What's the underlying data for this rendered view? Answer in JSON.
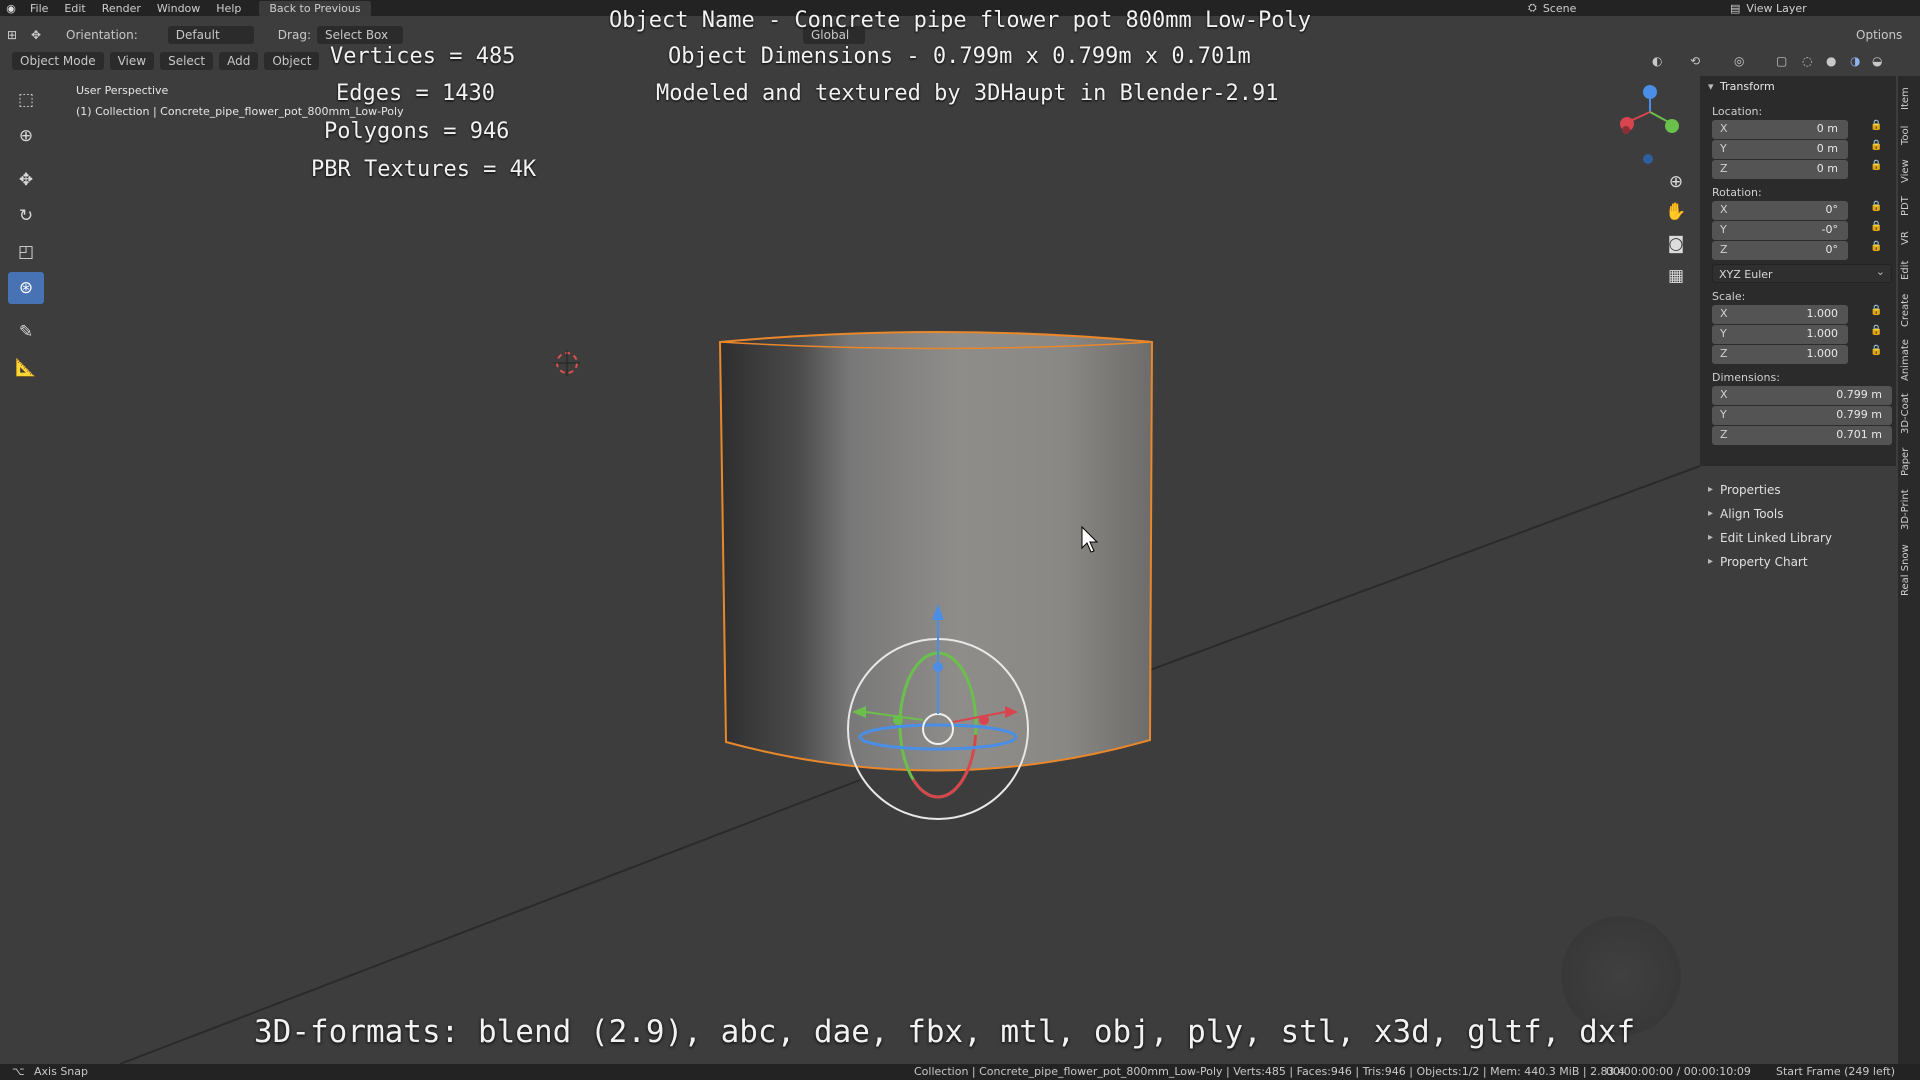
{
  "topbar": {
    "menus": [
      "File",
      "Edit",
      "Render",
      "Window",
      "Help"
    ],
    "back_button": "Back to Previous",
    "scene": "Scene",
    "view_layer": "View Layer"
  },
  "header": {
    "orientation_label": "Orientation:",
    "orientation_value": "Default",
    "drag_label": "Drag:",
    "drag_value": "Select Box",
    "transform_space": "Global",
    "options": "Options",
    "mode": "Object Mode",
    "view": "View",
    "select": "Select",
    "add": "Add",
    "object": "Object"
  },
  "viewport": {
    "perspective": "User Perspective",
    "collection": "(1) Collection | Concrete_pipe_flower_pot_800mm_Low-Poly"
  },
  "overlay": {
    "vertices": "Vertices = 485",
    "edges": "Edges = 1430",
    "polygons": "Polygons = 946",
    "textures": "PBR Textures = 4K",
    "object_name": "Object Name - Concrete pipe flower pot 800mm Low-Poly",
    "dimensions": "Object Dimensions -  0.799m x 0.799m x 0.701m",
    "credit": "Modeled and textured by 3DHaupt in Blender-2.91",
    "formats": "3D-formats: blend (2.9), abc, dae, fbx, mtl, obj, ply, stl, x3d, gltf, dxf"
  },
  "npanel": {
    "title": "Transform",
    "location_label": "Location:",
    "location": [
      {
        "axis": "X",
        "value": "0 m"
      },
      {
        "axis": "Y",
        "value": "0 m"
      },
      {
        "axis": "Z",
        "value": "0 m"
      }
    ],
    "rotation_label": "Rotation:",
    "rotation": [
      {
        "axis": "X",
        "value": "0°"
      },
      {
        "axis": "Y",
        "value": "-0°"
      },
      {
        "axis": "Z",
        "value": "0°"
      }
    ],
    "rotation_mode": "XYZ Euler",
    "scale_label": "Scale:",
    "scale": [
      {
        "axis": "X",
        "value": "1.000"
      },
      {
        "axis": "Y",
        "value": "1.000"
      },
      {
        "axis": "Z",
        "value": "1.000"
      }
    ],
    "dimensions_label": "Dimensions:",
    "dimensions": [
      {
        "axis": "X",
        "value": "0.799 m"
      },
      {
        "axis": "Y",
        "value": "0.799 m"
      },
      {
        "axis": "Z",
        "value": "0.701 m"
      }
    ],
    "subpanels": [
      "Properties",
      "Align Tools",
      "Edit Linked Library",
      "Property Chart"
    ]
  },
  "vtabs": [
    "Item",
    "Tool",
    "View",
    "PDT",
    "VR",
    "Edit",
    "Create",
    "Animate",
    "3D-Coat",
    "Paper",
    "3D-Print",
    "Real Snow"
  ],
  "status": {
    "left": "Axis Snap",
    "center": "Collection | Concrete_pipe_flower_pot_800mm_Low-Poly | Verts:485 | Faces:946 | Tris:946 | Objects:1/2 | Mem: 440.3 MiB | 2.83.4",
    "time": "00:00:00:00 / 00:00:10:09",
    "frame": "Start Frame (249 left)"
  },
  "gizmo_axes": {
    "x": "X",
    "y": "Y",
    "z": "Z"
  }
}
